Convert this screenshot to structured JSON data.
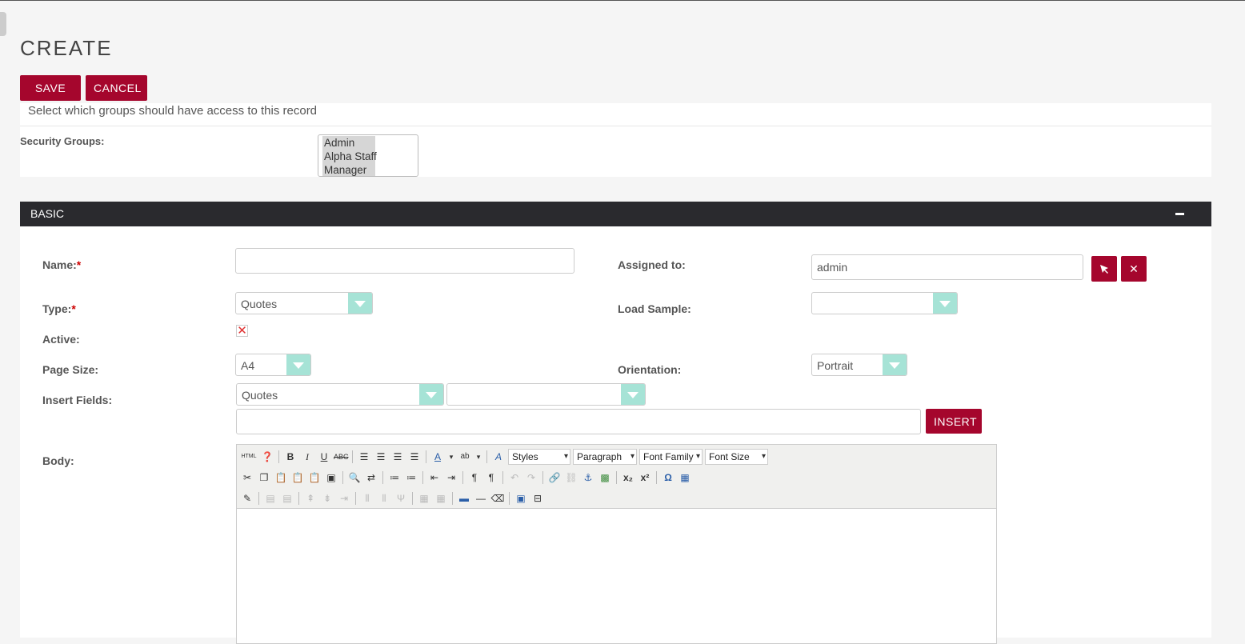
{
  "page": {
    "title": "CREATE"
  },
  "actions": {
    "save": "SAVE",
    "cancel": "CANCEL"
  },
  "security": {
    "hint": "Select which groups should have access to this record",
    "label": "Security Groups:",
    "options": [
      "Admin",
      "Alpha Staff",
      "Manager"
    ]
  },
  "panel": {
    "title": "BASIC"
  },
  "form": {
    "name_label": "Name:",
    "name_value": "",
    "type_label": "Type:",
    "type_value": "Quotes",
    "active_label": "Active:",
    "page_size_label": "Page Size:",
    "page_size_value": "A4",
    "insert_fields_label": "Insert Fields:",
    "insert_module_value": "Quotes",
    "insert_field_value": "",
    "insert_text_value": "",
    "insert_button": "INSERT",
    "body_label": "Body:",
    "assigned_label": "Assigned to:",
    "assigned_value": "admin",
    "load_sample_label": "Load Sample:",
    "load_sample_value": "",
    "orientation_label": "Orientation:",
    "orientation_value": "Portrait"
  },
  "editor": {
    "styles": "Styles",
    "format": "Paragraph",
    "font_family": "Font Family",
    "font_size": "Font Size"
  },
  "colors": {
    "accent": "#a5062d",
    "dropdown_arrow": "#a6e3d6",
    "bar": "#2a2a2e"
  }
}
